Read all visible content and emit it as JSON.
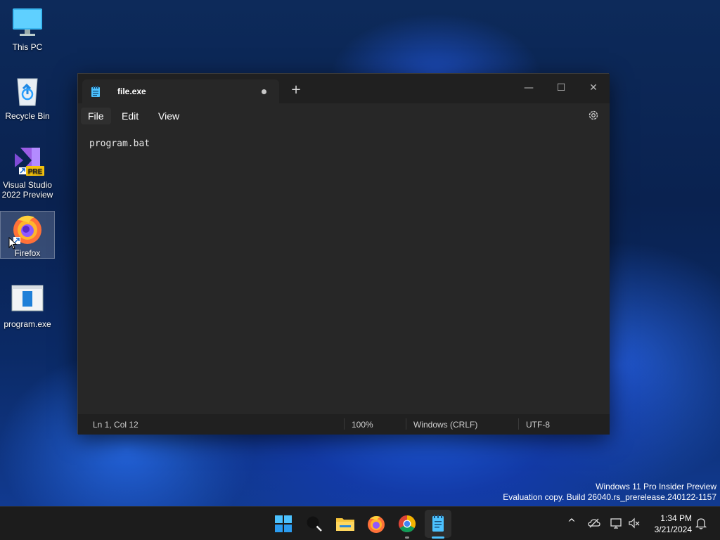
{
  "desktop": {
    "icons": [
      {
        "label": "This PC",
        "icon": "monitor-icon"
      },
      {
        "label": "Recycle Bin",
        "icon": "recycle-bin-icon"
      },
      {
        "label": "Visual Studio 2022 Preview",
        "icon": "visual-studio-icon",
        "badge": "PRE"
      },
      {
        "label": "Firefox",
        "icon": "firefox-icon"
      },
      {
        "label": "program.exe",
        "icon": "executable-icon"
      }
    ]
  },
  "notepad": {
    "tab_title": "file.exe",
    "new_tab_glyph": "+",
    "minimize_glyph": "—",
    "maximize_glyph": "☐",
    "close_glyph": "✕",
    "menu": {
      "file": "File",
      "edit": "Edit",
      "view": "View"
    },
    "content": "program.bat",
    "status": {
      "position": "Ln 1, Col 12",
      "zoom": "100%",
      "line_ending": "Windows (CRLF)",
      "encoding": "UTF-8"
    }
  },
  "watermark": {
    "line1": "Windows 11 Pro Insider Preview",
    "line2": "Evaluation copy. Build 26040.rs_prerelease.240122-1157"
  },
  "taskbar": {
    "clock_time": "1:34 PM",
    "clock_date": "3/21/2024",
    "chevron_glyph": "^"
  },
  "colors": {
    "accent": "#0078d4",
    "window_bg": "#272727",
    "titlebar_bg": "#202020"
  }
}
